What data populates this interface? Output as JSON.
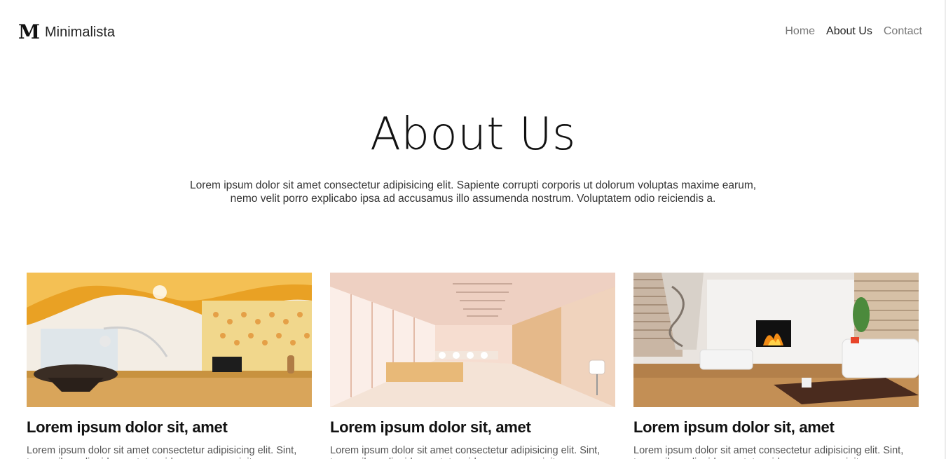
{
  "header": {
    "logo_mark": "M",
    "brand_name": "Minimalista",
    "nav": [
      {
        "label": "Home",
        "active": false
      },
      {
        "label": "About Us",
        "active": true
      },
      {
        "label": "Contact",
        "active": false
      }
    ]
  },
  "hero": {
    "title": "About Us",
    "text": "Lorem ipsum dolor sit amet consectetur adipisicing elit. Sapiente corrupti corporis ut dolorum voluptas maxime earum, nemo velit porro explicabo ipsa ad accusamus illo assumenda nostrum. Voluptatem odio reiciendis a."
  },
  "cards": [
    {
      "image": "modern-living-room-orange-ceiling",
      "title": "Lorem ipsum dolor sit, amet",
      "text": "Lorem ipsum dolor sit amet consectetur adipisicing elit. Sint, temporibus aliquid quos totam id quo nam suscipit"
    },
    {
      "image": "bright-office-conference-room",
      "title": "Lorem ipsum dolor sit, amet",
      "text": "Lorem ipsum dolor sit amet consectetur adipisicing elit. Sint, temporibus aliquid quos totam id quo nam suscipit"
    },
    {
      "image": "living-room-fireplace",
      "title": "Lorem ipsum dolor sit, amet",
      "text": "Lorem ipsum dolor sit amet consectetur adipisicing elit. Sint, temporibus aliquid quos totam id quo nam suscipit"
    }
  ]
}
